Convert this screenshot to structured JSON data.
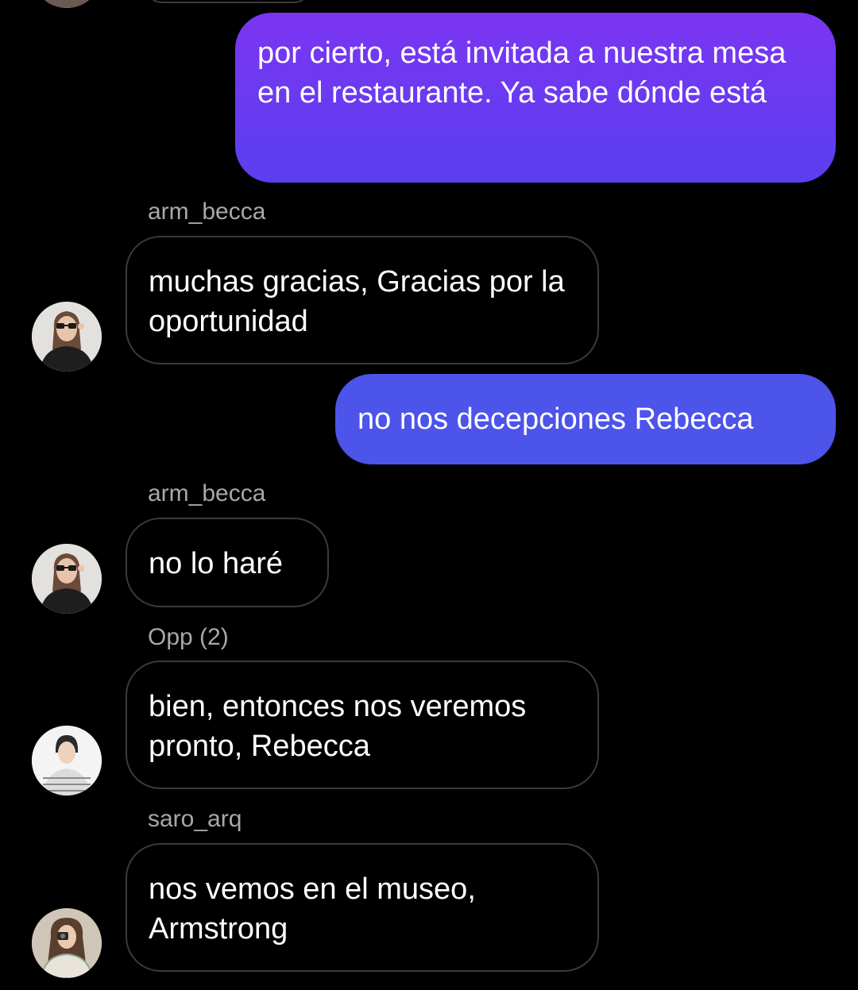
{
  "colors": {
    "background": "#000000",
    "outgoing_gradient_top": "#7b35f2",
    "outgoing_gradient_bottom": "#5a3ff0",
    "outgoing_solid": "#4d54ea",
    "incoming_border": "#3a3a3a",
    "sender_text": "#a8a8a8"
  },
  "messages": [
    {
      "direction": "outgoing",
      "text": "por cierto, está invitada a nuestra mesa en el restaurante. Ya sabe dónde está"
    },
    {
      "direction": "incoming",
      "sender": "arm_becca",
      "avatar": "woman-sunglasses-avatar",
      "text": "muchas gracias, Gracias por la oportunidad"
    },
    {
      "direction": "outgoing",
      "text": "no nos decepciones Rebecca"
    },
    {
      "direction": "incoming",
      "sender": "arm_becca",
      "avatar": "woman-sunglasses-avatar",
      "text": "no lo haré"
    },
    {
      "direction": "incoming",
      "sender": "Opp (2)",
      "avatar": "man-avatar",
      "text": "bien, entonces nos veremos pronto, Rebecca"
    },
    {
      "direction": "incoming",
      "sender": "saro_arq",
      "avatar": "woman-camera-avatar",
      "text": "nos vemos en el museo, Armstrong"
    }
  ]
}
